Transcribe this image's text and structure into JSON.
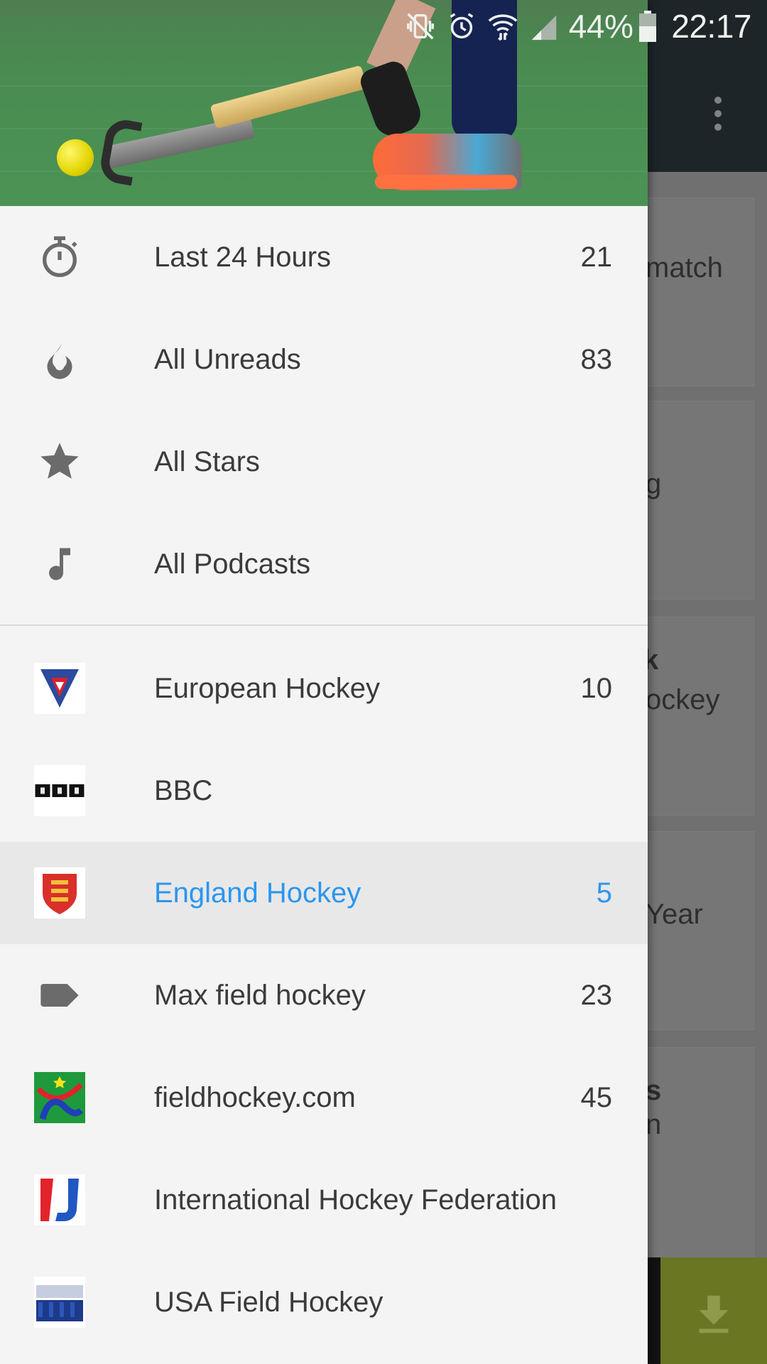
{
  "status_bar": {
    "battery": "44%",
    "time": "22:17"
  },
  "background": {
    "cards": [
      "match",
      "g",
      "k",
      "ockey",
      "Year",
      "s",
      "n"
    ]
  },
  "drawer": {
    "smart_feeds": [
      {
        "label": "Last 24 Hours",
        "count": "21",
        "icon": "stopwatch-icon"
      },
      {
        "label": "All Unreads",
        "count": "83",
        "icon": "flame-icon"
      },
      {
        "label": "All Stars",
        "count": "",
        "icon": "star-icon"
      },
      {
        "label": "All Podcasts",
        "count": "",
        "icon": "music-note-icon"
      }
    ],
    "feeds": [
      {
        "label": "European Hockey",
        "count": "10",
        "icon": "european-hockey-logo-icon"
      },
      {
        "label": "BBC",
        "count": "",
        "icon": "bbc-logo-icon"
      },
      {
        "label": "England Hockey",
        "count": "5",
        "icon": "england-hockey-shield-icon",
        "selected": true
      },
      {
        "label": "Max field hockey",
        "count": "23",
        "icon": "tag-icon"
      },
      {
        "label": "fieldhockey.com",
        "count": "45",
        "icon": "fieldhockey-logo-icon"
      },
      {
        "label": "International Hockey Federation",
        "count": "",
        "icon": "fih-logo-icon"
      },
      {
        "label": "USA Field Hockey",
        "count": "",
        "icon": "team-usa-logo-icon"
      }
    ],
    "selected_color": "#2b96f0"
  }
}
